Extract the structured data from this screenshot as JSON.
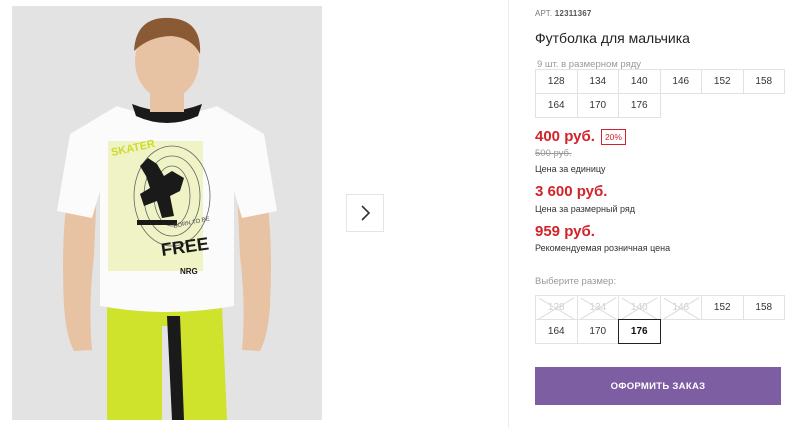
{
  "gallery": {
    "photo_alt": "Футболка для мальчика",
    "print": {
      "skater": "SKATER",
      "born": "BORN TO BE",
      "free": "FREE",
      "brand": "NRG"
    },
    "arrow_icon": "chevron-right-icon"
  },
  "product": {
    "article_label": "АРТ.",
    "article_number": "12311367",
    "title": "Футболка для мальчика",
    "row_count": "9 шт. в размерном ряду",
    "size_row": [
      "128",
      "134",
      "140",
      "146",
      "152",
      "158",
      "164",
      "170",
      "176"
    ]
  },
  "prices": {
    "current": "400 руб.",
    "discount": "20%",
    "old": "500 руб.",
    "unit_caption": "Цена за единицу",
    "row_price": "3 600 руб.",
    "row_caption": "Цена за размерный ряд",
    "rrp": "959 руб.",
    "rrp_caption": "Рекомендуемая розничная цена"
  },
  "size_select": {
    "label": "Выберите размер:",
    "sizes": [
      {
        "label": "128",
        "available": false
      },
      {
        "label": "134",
        "available": false
      },
      {
        "label": "140",
        "available": false
      },
      {
        "label": "146",
        "available": false
      },
      {
        "label": "152",
        "available": true
      },
      {
        "label": "158",
        "available": true
      },
      {
        "label": "164",
        "available": true
      },
      {
        "label": "170",
        "available": true
      },
      {
        "label": "176",
        "available": true,
        "selected": true
      }
    ]
  },
  "order_button": "ОФОРМИТЬ ЗАКАЗ",
  "colors": {
    "accent": "#7d5ea3",
    "price": "#d2232a",
    "neon": "#cddc28"
  }
}
